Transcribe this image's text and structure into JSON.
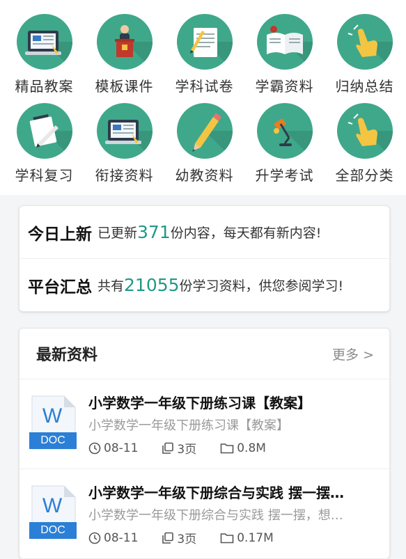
{
  "categories": [
    {
      "label": "精品教案",
      "icon": "laptop-lesson-icon"
    },
    {
      "label": "模板课件",
      "icon": "podium-speaker-icon"
    },
    {
      "label": "学科试卷",
      "icon": "notebook-pencil-icon"
    },
    {
      "label": "学霸资料",
      "icon": "open-book-icon"
    },
    {
      "label": "归纳总结",
      "icon": "hand-pointer-icon"
    },
    {
      "label": "学科复习",
      "icon": "notepad-pen-icon"
    },
    {
      "label": "衔接资料",
      "icon": "laptop-lesson-icon"
    },
    {
      "label": "幼教资料",
      "icon": "pencil-icon"
    },
    {
      "label": "升学考试",
      "icon": "desk-lamp-icon"
    },
    {
      "label": "全部分类",
      "icon": "hand-pointer-icon"
    }
  ],
  "stats": {
    "today": {
      "title": "今日上新",
      "prefix": "已更新",
      "count": "371",
      "suffix": "份内容，每天都有新内容!"
    },
    "total": {
      "title": "平台汇总",
      "prefix": "共有",
      "count": "21055",
      "suffix": "份学习资料，供您参阅学习!"
    }
  },
  "latest": {
    "title": "最新资料",
    "more": "更多 >",
    "items": [
      {
        "title": "小学数学一年级下册练习课【教案】",
        "desc": "小学数学一年级下册练习课【教案】",
        "date": "08-11",
        "pages": "3页",
        "size": "0.8M",
        "badge": "DOC",
        "letter": "W"
      },
      {
        "title": "小学数学一年级下册综合与实践 摆一摆…",
        "desc": "小学数学一年级下册综合与实践 摆一摆，想…",
        "date": "08-11",
        "pages": "3页",
        "size": "0.17M",
        "badge": "DOC",
        "letter": "W"
      }
    ]
  },
  "colors": {
    "accent": "#3fa88a",
    "number": "#1f9a86",
    "doc_blue": "#2b7fd6"
  }
}
